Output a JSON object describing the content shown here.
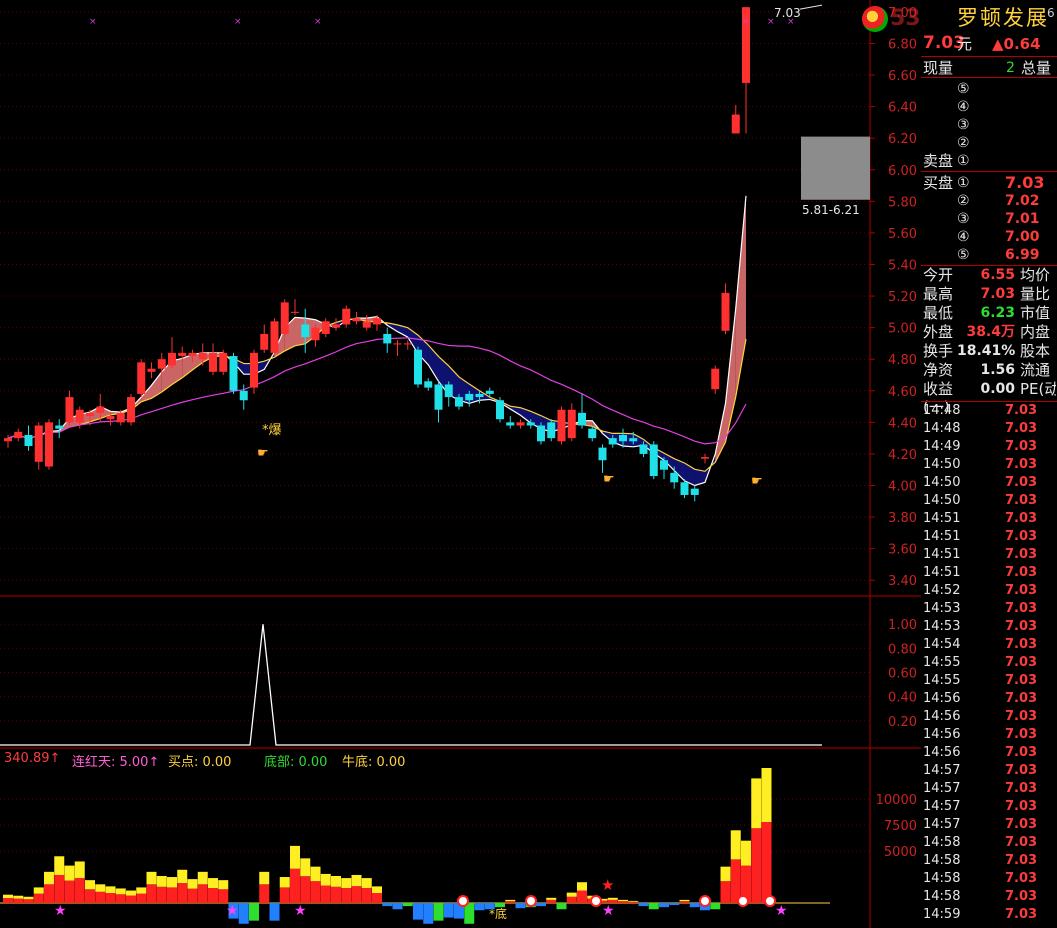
{
  "header": {
    "stock_name": "罗顿发展",
    "page_no": "6",
    "watermark": "53"
  },
  "quote": {
    "price": "7.03",
    "price_unit": "元",
    "change": "▲0.64",
    "volume_now_label": "现量",
    "volume_now": "2",
    "volume_total_label": "总量",
    "sell_label": "卖盘",
    "buy_label": "买盘",
    "sell_levels": [
      "⑤",
      "④",
      "③",
      "②",
      "①"
    ],
    "buy_levels": [
      {
        "n": "①",
        "price": "7.03"
      },
      {
        "n": "②",
        "price": "7.02"
      },
      {
        "n": "③",
        "price": "7.01"
      },
      {
        "n": "④",
        "price": "7.00"
      },
      {
        "n": "⑤",
        "price": "6.99"
      }
    ],
    "stats": [
      {
        "l1": "今开",
        "v1": "6.55",
        "c1": "red",
        "l2": "均价"
      },
      {
        "l1": "最高",
        "v1": "7.03",
        "c1": "red",
        "l2": "量比"
      },
      {
        "l1": "最低",
        "v1": "6.23",
        "c1": "green",
        "l2": "市值"
      },
      {
        "l1": "外盘",
        "v1": "38.4万",
        "c1": "red",
        "l2": "内盘"
      },
      {
        "l1": "换手",
        "v1": "18.41%",
        "c1": "white",
        "l2": "股本"
      },
      {
        "l1": "净资",
        "v1": "1.56",
        "c1": "white",
        "l2": "流通"
      },
      {
        "l1": "收益(一)",
        "v1": "0.00",
        "c1": "white",
        "l2": "PE(动)"
      }
    ],
    "ticks": [
      {
        "t": "14:48",
        "p": "7.03"
      },
      {
        "t": "14:48",
        "p": "7.03"
      },
      {
        "t": "14:49",
        "p": "7.03"
      },
      {
        "t": "14:50",
        "p": "7.03"
      },
      {
        "t": "14:50",
        "p": "7.03"
      },
      {
        "t": "14:50",
        "p": "7.03"
      },
      {
        "t": "14:51",
        "p": "7.03"
      },
      {
        "t": "14:51",
        "p": "7.03"
      },
      {
        "t": "14:51",
        "p": "7.03"
      },
      {
        "t": "14:51",
        "p": "7.03"
      },
      {
        "t": "14:52",
        "p": "7.03"
      },
      {
        "t": "14:53",
        "p": "7.03"
      },
      {
        "t": "14:53",
        "p": "7.03"
      },
      {
        "t": "14:54",
        "p": "7.03"
      },
      {
        "t": "14:55",
        "p": "7.03"
      },
      {
        "t": "14:55",
        "p": "7.03"
      },
      {
        "t": "14:56",
        "p": "7.03"
      },
      {
        "t": "14:56",
        "p": "7.03"
      },
      {
        "t": "14:56",
        "p": "7.03"
      },
      {
        "t": "14:56",
        "p": "7.03"
      },
      {
        "t": "14:57",
        "p": "7.03"
      },
      {
        "t": "14:57",
        "p": "7.03"
      },
      {
        "t": "14:57",
        "p": "7.03"
      },
      {
        "t": "14:57",
        "p": "7.03"
      },
      {
        "t": "14:58",
        "p": "7.03"
      },
      {
        "t": "14:58",
        "p": "7.03"
      },
      {
        "t": "14:58",
        "p": "7.03"
      },
      {
        "t": "14:58",
        "p": "7.03"
      },
      {
        "t": "14:59",
        "p": "7.03"
      }
    ]
  },
  "indicator": {
    "first_value": "340.89↑",
    "items": [
      {
        "label": "连红天: 5.00↑",
        "color": "#ff5fd2"
      },
      {
        "label": "买点: 0.00",
        "color": "#ffd23c"
      },
      {
        "label": "底部: 0.00",
        "color": "#2dde2d"
      },
      {
        "label": "牛底: 0.00",
        "color": "#ffd23c"
      }
    ]
  },
  "annotations": {
    "high_label": "7.03",
    "box_label": "5.81-6.21",
    "bao": "*爆",
    "di": "*底"
  },
  "chart_data": [
    {
      "type": "candlestick",
      "ylim": [
        3.3,
        7.05
      ],
      "yticks": [
        "7.00",
        "6.80",
        "6.60",
        "6.40",
        "6.20",
        "6.00",
        "5.80",
        "5.60",
        "5.40",
        "5.20",
        "5.00",
        "4.80",
        "4.60",
        "4.40",
        "4.20",
        "4.00",
        "3.80",
        "3.60",
        "3.40"
      ],
      "candles": [
        {
          "o": 4.28,
          "h": 4.32,
          "l": 4.24,
          "c": 4.3
        },
        {
          "o": 4.3,
          "h": 4.36,
          "l": 4.28,
          "c": 4.34
        },
        {
          "o": 4.32,
          "h": 4.38,
          "l": 4.22,
          "c": 4.25
        },
        {
          "o": 4.15,
          "h": 4.4,
          "l": 4.1,
          "c": 4.38
        },
        {
          "o": 4.12,
          "h": 4.42,
          "l": 4.1,
          "c": 4.4
        },
        {
          "o": 4.38,
          "h": 4.42,
          "l": 4.3,
          "c": 4.36
        },
        {
          "o": 4.4,
          "h": 4.6,
          "l": 4.38,
          "c": 4.56
        },
        {
          "o": 4.4,
          "h": 4.5,
          "l": 4.36,
          "c": 4.48
        },
        {
          "o": 4.44,
          "h": 4.48,
          "l": 4.38,
          "c": 4.46
        },
        {
          "o": 4.46,
          "h": 4.58,
          "l": 4.4,
          "c": 4.5
        },
        {
          "o": 4.42,
          "h": 4.46,
          "l": 4.38,
          "c": 4.44
        },
        {
          "o": 4.4,
          "h": 4.48,
          "l": 4.38,
          "c": 4.46
        },
        {
          "o": 4.4,
          "h": 4.58,
          "l": 4.38,
          "c": 4.56
        },
        {
          "o": 4.58,
          "h": 4.8,
          "l": 4.56,
          "c": 4.78
        },
        {
          "o": 4.72,
          "h": 4.78,
          "l": 4.68,
          "c": 4.74
        },
        {
          "o": 4.74,
          "h": 4.84,
          "l": 4.7,
          "c": 4.8
        },
        {
          "o": 4.76,
          "h": 4.94,
          "l": 4.74,
          "c": 4.84
        },
        {
          "o": 4.82,
          "h": 4.88,
          "l": 4.78,
          "c": 4.84
        },
        {
          "o": 4.82,
          "h": 4.86,
          "l": 4.78,
          "c": 4.84
        },
        {
          "o": 4.8,
          "h": 4.9,
          "l": 4.76,
          "c": 4.84
        },
        {
          "o": 4.72,
          "h": 4.9,
          "l": 4.7,
          "c": 4.84
        },
        {
          "o": 4.72,
          "h": 4.86,
          "l": 4.7,
          "c": 4.84
        },
        {
          "o": 4.82,
          "h": 4.84,
          "l": 4.58,
          "c": 4.6
        },
        {
          "o": 4.6,
          "h": 4.64,
          "l": 4.48,
          "c": 4.54
        },
        {
          "o": 4.62,
          "h": 4.86,
          "l": 4.58,
          "c": 4.84
        },
        {
          "o": 4.86,
          "h": 5.02,
          "l": 4.84,
          "c": 4.96
        },
        {
          "o": 4.84,
          "h": 5.06,
          "l": 4.82,
          "c": 5.04
        },
        {
          "o": 4.96,
          "h": 5.18,
          "l": 4.94,
          "c": 5.16
        },
        {
          "o": 5.1,
          "h": 5.18,
          "l": 5.08,
          "c": 5.1
        },
        {
          "o": 5.02,
          "h": 5.12,
          "l": 4.84,
          "c": 4.94
        },
        {
          "o": 4.92,
          "h": 5.02,
          "l": 4.88,
          "c": 5.0
        },
        {
          "o": 4.96,
          "h": 5.06,
          "l": 4.94,
          "c": 5.04
        },
        {
          "o": 5.0,
          "h": 5.06,
          "l": 4.98,
          "c": 5.02
        },
        {
          "o": 5.02,
          "h": 5.14,
          "l": 5.0,
          "c": 5.12
        },
        {
          "o": 5.04,
          "h": 5.1,
          "l": 5.02,
          "c": 5.06
        },
        {
          "o": 5.0,
          "h": 5.08,
          "l": 4.98,
          "c": 5.04
        },
        {
          "o": 5.02,
          "h": 5.08,
          "l": 4.98,
          "c": 5.06
        },
        {
          "o": 4.96,
          "h": 5.0,
          "l": 4.84,
          "c": 4.9
        },
        {
          "o": 4.9,
          "h": 4.92,
          "l": 4.82,
          "c": 4.9
        },
        {
          "o": 4.9,
          "h": 4.92,
          "l": 4.86,
          "c": 4.9
        },
        {
          "o": 4.86,
          "h": 4.88,
          "l": 4.62,
          "c": 4.64
        },
        {
          "o": 4.66,
          "h": 4.68,
          "l": 4.6,
          "c": 4.62
        },
        {
          "o": 4.64,
          "h": 4.66,
          "l": 4.4,
          "c": 4.48
        },
        {
          "o": 4.64,
          "h": 4.66,
          "l": 4.5,
          "c": 4.56
        },
        {
          "o": 4.56,
          "h": 4.58,
          "l": 4.48,
          "c": 4.5
        },
        {
          "o": 4.58,
          "h": 4.6,
          "l": 4.5,
          "c": 4.54
        },
        {
          "o": 4.58,
          "h": 4.6,
          "l": 4.52,
          "c": 4.56
        },
        {
          "o": 4.6,
          "h": 4.62,
          "l": 4.56,
          "c": 4.58
        },
        {
          "o": 4.54,
          "h": 4.56,
          "l": 4.4,
          "c": 4.42
        },
        {
          "o": 4.4,
          "h": 4.44,
          "l": 4.36,
          "c": 4.38
        },
        {
          "o": 4.38,
          "h": 4.42,
          "l": 4.36,
          "c": 4.4
        },
        {
          "o": 4.4,
          "h": 4.42,
          "l": 4.36,
          "c": 4.38
        },
        {
          "o": 4.38,
          "h": 4.4,
          "l": 4.26,
          "c": 4.28
        },
        {
          "o": 4.4,
          "h": 4.42,
          "l": 4.28,
          "c": 4.3
        },
        {
          "o": 4.28,
          "h": 4.5,
          "l": 4.26,
          "c": 4.48
        },
        {
          "o": 4.3,
          "h": 4.52,
          "l": 4.28,
          "c": 4.48
        },
        {
          "o": 4.46,
          "h": 4.58,
          "l": 4.36,
          "c": 4.38
        },
        {
          "o": 4.36,
          "h": 4.38,
          "l": 4.28,
          "c": 4.3
        },
        {
          "o": 4.24,
          "h": 4.26,
          "l": 4.08,
          "c": 4.16
        },
        {
          "o": 4.3,
          "h": 4.32,
          "l": 4.24,
          "c": 4.26
        },
        {
          "o": 4.32,
          "h": 4.36,
          "l": 4.24,
          "c": 4.28
        },
        {
          "o": 4.3,
          "h": 4.34,
          "l": 4.26,
          "c": 4.28
        },
        {
          "o": 4.26,
          "h": 4.28,
          "l": 4.18,
          "c": 4.2
        },
        {
          "o": 4.26,
          "h": 4.28,
          "l": 4.04,
          "c": 4.06
        },
        {
          "o": 4.16,
          "h": 4.18,
          "l": 4.04,
          "c": 4.1
        },
        {
          "o": 4.08,
          "h": 4.12,
          "l": 3.98,
          "c": 4.02
        },
        {
          "o": 4.02,
          "h": 4.04,
          "l": 3.92,
          "c": 3.94
        },
        {
          "o": 3.98,
          "h": 4.0,
          "l": 3.9,
          "c": 3.94
        },
        {
          "o": 4.17,
          "h": 4.2,
          "l": 4.14,
          "c": 4.18
        },
        {
          "o": 4.61,
          "h": 4.76,
          "l": 4.58,
          "c": 4.74
        },
        {
          "o": 4.98,
          "h": 5.28,
          "l": 4.96,
          "c": 5.22
        },
        {
          "o": 6.23,
          "h": 6.41,
          "l": 6.23,
          "c": 6.35
        },
        {
          "o": 6.55,
          "h": 7.03,
          "l": 6.23,
          "c": 7.03
        }
      ]
    },
    {
      "type": "line",
      "ylim": [
        0,
        1.2
      ],
      "yticks": [
        "1.00",
        "0.80",
        "0.60",
        "0.40",
        "0.20"
      ]
    },
    {
      "type": "bar",
      "yticks": [
        "10000",
        "7500",
        "5000"
      ],
      "ylim": [
        0,
        13000
      ]
    }
  ]
}
